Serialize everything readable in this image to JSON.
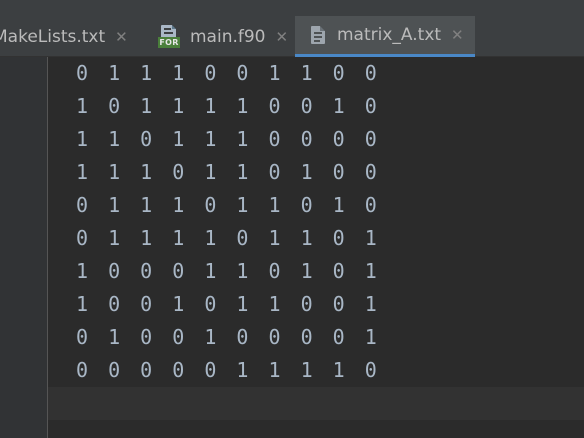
{
  "tabs": [
    {
      "label": "MakeLists.txt",
      "close": "✕",
      "icon": "none",
      "active": false
    },
    {
      "label": "main.f90",
      "close": "✕",
      "icon": "fortran-file-icon",
      "active": false
    },
    {
      "label": "matrix_A.txt",
      "close": "✕",
      "icon": "text-file-icon",
      "active": true
    }
  ],
  "for_badge": "FOR",
  "lines": [
    "0 1 1 1 0 0 1 1 0 0",
    "1 0 1 1 1 1 0 0 1 0",
    "1 1 0 1 1 1 0 0 0 0",
    "1 1 1 0 1 1 0 1 0 0",
    "0 1 1 1 0 1 1 0 1 0",
    "0 1 1 1 1 0 1 1 0 1",
    "1 0 0 0 1 1 0 1 0 1",
    "1 0 0 1 0 1 1 0 0 1",
    "0 1 0 0 1 0 0 0 0 1",
    "0 0 0 0 0 1 1 1 1 0"
  ],
  "colors": {
    "accent": "#4a88c7",
    "editor_bg": "#2b2b2b",
    "text": "#a9b7c6"
  }
}
